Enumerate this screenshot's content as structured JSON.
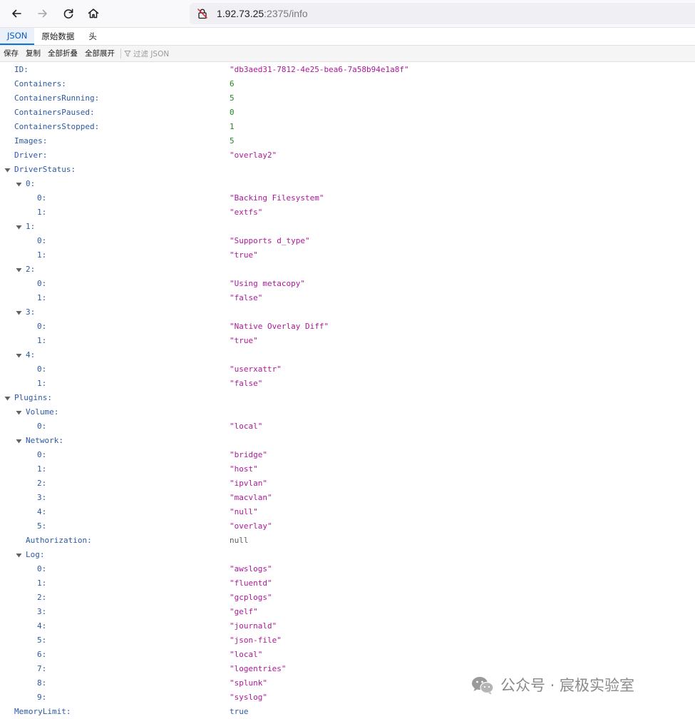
{
  "browser": {
    "url_host": "1.92.73.25",
    "url_rest": ":2375/info"
  },
  "tabs": [
    {
      "label": "JSON",
      "active": true
    },
    {
      "label": "原始数据",
      "active": false
    },
    {
      "label": "头",
      "active": false
    }
  ],
  "toolbar": {
    "save": "保存",
    "copy": "复制",
    "collapse_all": "全部折叠",
    "expand_all": "全部展开",
    "filter_placeholder": "过滤 JSON"
  },
  "json_rows": [
    {
      "key": "ID:",
      "value": "\"db3aed31-7812-4e25-bea6-7a58b94e1a8f\"",
      "type": "str",
      "depth": 0,
      "twisty": false
    },
    {
      "key": "Containers:",
      "value": "6",
      "type": "num",
      "depth": 0,
      "twisty": false
    },
    {
      "key": "ContainersRunning:",
      "value": "5",
      "type": "num",
      "depth": 0,
      "twisty": false
    },
    {
      "key": "ContainersPaused:",
      "value": "0",
      "type": "num",
      "depth": 0,
      "twisty": false
    },
    {
      "key": "ContainersStopped:",
      "value": "1",
      "type": "num",
      "depth": 0,
      "twisty": false
    },
    {
      "key": "Images:",
      "value": "5",
      "type": "num",
      "depth": 0,
      "twisty": false
    },
    {
      "key": "Driver:",
      "value": "\"overlay2\"",
      "type": "str",
      "depth": 0,
      "twisty": false
    },
    {
      "key": "DriverStatus:",
      "value": "",
      "type": "obj",
      "depth": 0,
      "twisty": true
    },
    {
      "key": "0:",
      "value": "",
      "type": "obj",
      "depth": 1,
      "twisty": true
    },
    {
      "key": "0:",
      "value": "\"Backing Filesystem\"",
      "type": "str",
      "depth": 2,
      "twisty": false
    },
    {
      "key": "1:",
      "value": "\"extfs\"",
      "type": "str",
      "depth": 2,
      "twisty": false
    },
    {
      "key": "1:",
      "value": "",
      "type": "obj",
      "depth": 1,
      "twisty": true
    },
    {
      "key": "0:",
      "value": "\"Supports d_type\"",
      "type": "str",
      "depth": 2,
      "twisty": false
    },
    {
      "key": "1:",
      "value": "\"true\"",
      "type": "str",
      "depth": 2,
      "twisty": false
    },
    {
      "key": "2:",
      "value": "",
      "type": "obj",
      "depth": 1,
      "twisty": true
    },
    {
      "key": "0:",
      "value": "\"Using metacopy\"",
      "type": "str",
      "depth": 2,
      "twisty": false
    },
    {
      "key": "1:",
      "value": "\"false\"",
      "type": "str",
      "depth": 2,
      "twisty": false
    },
    {
      "key": "3:",
      "value": "",
      "type": "obj",
      "depth": 1,
      "twisty": true
    },
    {
      "key": "0:",
      "value": "\"Native Overlay Diff\"",
      "type": "str",
      "depth": 2,
      "twisty": false
    },
    {
      "key": "1:",
      "value": "\"true\"",
      "type": "str",
      "depth": 2,
      "twisty": false
    },
    {
      "key": "4:",
      "value": "",
      "type": "obj",
      "depth": 1,
      "twisty": true
    },
    {
      "key": "0:",
      "value": "\"userxattr\"",
      "type": "str",
      "depth": 2,
      "twisty": false
    },
    {
      "key": "1:",
      "value": "\"false\"",
      "type": "str",
      "depth": 2,
      "twisty": false
    },
    {
      "key": "Plugins:",
      "value": "",
      "type": "obj",
      "depth": 0,
      "twisty": true
    },
    {
      "key": "Volume:",
      "value": "",
      "type": "obj",
      "depth": 1,
      "twisty": true
    },
    {
      "key": "0:",
      "value": "\"local\"",
      "type": "str",
      "depth": 2,
      "twisty": false
    },
    {
      "key": "Network:",
      "value": "",
      "type": "obj",
      "depth": 1,
      "twisty": true
    },
    {
      "key": "0:",
      "value": "\"bridge\"",
      "type": "str",
      "depth": 2,
      "twisty": false
    },
    {
      "key": "1:",
      "value": "\"host\"",
      "type": "str",
      "depth": 2,
      "twisty": false
    },
    {
      "key": "2:",
      "value": "\"ipvlan\"",
      "type": "str",
      "depth": 2,
      "twisty": false
    },
    {
      "key": "3:",
      "value": "\"macvlan\"",
      "type": "str",
      "depth": 2,
      "twisty": false
    },
    {
      "key": "4:",
      "value": "\"null\"",
      "type": "str",
      "depth": 2,
      "twisty": false
    },
    {
      "key": "5:",
      "value": "\"overlay\"",
      "type": "str",
      "depth": 2,
      "twisty": false
    },
    {
      "key": "Authorization:",
      "value": "null",
      "type": "nul",
      "depth": 1,
      "twisty": false
    },
    {
      "key": "Log:",
      "value": "",
      "type": "obj",
      "depth": 1,
      "twisty": true
    },
    {
      "key": "0:",
      "value": "\"awslogs\"",
      "type": "str",
      "depth": 2,
      "twisty": false
    },
    {
      "key": "1:",
      "value": "\"fluentd\"",
      "type": "str",
      "depth": 2,
      "twisty": false
    },
    {
      "key": "2:",
      "value": "\"gcplogs\"",
      "type": "str",
      "depth": 2,
      "twisty": false
    },
    {
      "key": "3:",
      "value": "\"gelf\"",
      "type": "str",
      "depth": 2,
      "twisty": false
    },
    {
      "key": "4:",
      "value": "\"journald\"",
      "type": "str",
      "depth": 2,
      "twisty": false
    },
    {
      "key": "5:",
      "value": "\"json-file\"",
      "type": "str",
      "depth": 2,
      "twisty": false
    },
    {
      "key": "6:",
      "value": "\"local\"",
      "type": "str",
      "depth": 2,
      "twisty": false
    },
    {
      "key": "7:",
      "value": "\"logentries\"",
      "type": "str",
      "depth": 2,
      "twisty": false
    },
    {
      "key": "8:",
      "value": "\"splunk\"",
      "type": "str",
      "depth": 2,
      "twisty": false
    },
    {
      "key": "9:",
      "value": "\"syslog\"",
      "type": "str",
      "depth": 2,
      "twisty": false
    },
    {
      "key": "MemoryLimit:",
      "value": "true",
      "type": "bool",
      "depth": 0,
      "twisty": false
    }
  ],
  "watermark": {
    "text": "公众号 · 宸极实验室",
    "icon": "wechat-icon"
  },
  "colors": {
    "key": "#2b59a7",
    "string": "#b0169b",
    "number": "#1f8a1f",
    "null": "#5c5c5c",
    "tab_active": "#0a74da"
  }
}
